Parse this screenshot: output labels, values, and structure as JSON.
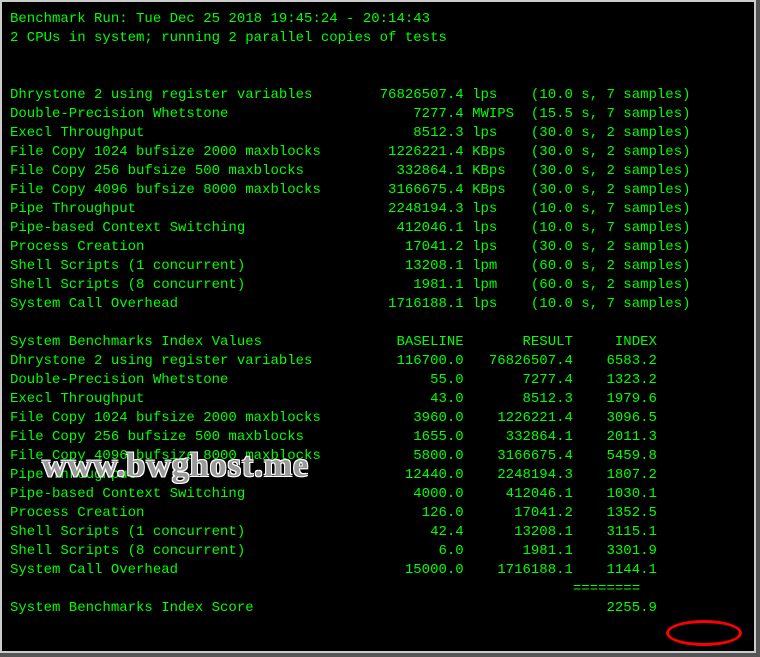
{
  "header": {
    "run_line": "Benchmark Run: Tue Dec 25 2018 19:45:24 - 20:14:43",
    "cpu_line": "2 CPUs in system; running 2 parallel copies of tests"
  },
  "results": [
    {
      "name": "Dhrystone 2 using register variables",
      "value": "76826507.4",
      "unit": "lps",
      "timing": "(10.0 s, 7 samples)"
    },
    {
      "name": "Double-Precision Whetstone",
      "value": "7277.4",
      "unit": "MWIPS",
      "timing": "(15.5 s, 7 samples)"
    },
    {
      "name": "Execl Throughput",
      "value": "8512.3",
      "unit": "lps",
      "timing": "(30.0 s, 2 samples)"
    },
    {
      "name": "File Copy 1024 bufsize 2000 maxblocks",
      "value": "1226221.4",
      "unit": "KBps",
      "timing": "(30.0 s, 2 samples)"
    },
    {
      "name": "File Copy 256 bufsize 500 maxblocks",
      "value": "332864.1",
      "unit": "KBps",
      "timing": "(30.0 s, 2 samples)"
    },
    {
      "name": "File Copy 4096 bufsize 8000 maxblocks",
      "value": "3166675.4",
      "unit": "KBps",
      "timing": "(30.0 s, 2 samples)"
    },
    {
      "name": "Pipe Throughput",
      "value": "2248194.3",
      "unit": "lps",
      "timing": "(10.0 s, 7 samples)"
    },
    {
      "name": "Pipe-based Context Switching",
      "value": "412046.1",
      "unit": "lps",
      "timing": "(10.0 s, 7 samples)"
    },
    {
      "name": "Process Creation",
      "value": "17041.2",
      "unit": "lps",
      "timing": "(30.0 s, 2 samples)"
    },
    {
      "name": "Shell Scripts (1 concurrent)",
      "value": "13208.1",
      "unit": "lpm",
      "timing": "(60.0 s, 2 samples)"
    },
    {
      "name": "Shell Scripts (8 concurrent)",
      "value": "1981.1",
      "unit": "lpm",
      "timing": "(60.0 s, 2 samples)"
    },
    {
      "name": "System Call Overhead",
      "value": "1716188.1",
      "unit": "lps",
      "timing": "(10.0 s, 7 samples)"
    }
  ],
  "index_header": {
    "title": "System Benchmarks Index Values",
    "baseline": "BASELINE",
    "result": "RESULT",
    "index": "INDEX"
  },
  "indexes": [
    {
      "name": "Dhrystone 2 using register variables",
      "baseline": "116700.0",
      "result": "76826507.4",
      "index": "6583.2"
    },
    {
      "name": "Double-Precision Whetstone",
      "baseline": "55.0",
      "result": "7277.4",
      "index": "1323.2"
    },
    {
      "name": "Execl Throughput",
      "baseline": "43.0",
      "result": "8512.3",
      "index": "1979.6"
    },
    {
      "name": "File Copy 1024 bufsize 2000 maxblocks",
      "baseline": "3960.0",
      "result": "1226221.4",
      "index": "3096.5"
    },
    {
      "name": "File Copy 256 bufsize 500 maxblocks",
      "baseline": "1655.0",
      "result": "332864.1",
      "index": "2011.3"
    },
    {
      "name": "File Copy 4096 bufsize 8000 maxblocks",
      "baseline": "5800.0",
      "result": "3166675.4",
      "index": "5459.8"
    },
    {
      "name": "Pipe Throughput",
      "baseline": "12440.0",
      "result": "2248194.3",
      "index": "1807.2"
    },
    {
      "name": "Pipe-based Context Switching",
      "baseline": "4000.0",
      "result": "412046.1",
      "index": "1030.1"
    },
    {
      "name": "Process Creation",
      "baseline": "126.0",
      "result": "17041.2",
      "index": "1352.5"
    },
    {
      "name": "Shell Scripts (1 concurrent)",
      "baseline": "42.4",
      "result": "13208.1",
      "index": "3115.1"
    },
    {
      "name": "Shell Scripts (8 concurrent)",
      "baseline": "6.0",
      "result": "1981.1",
      "index": "3301.9"
    },
    {
      "name": "System Call Overhead",
      "baseline": "15000.0",
      "result": "1716188.1",
      "index": "1144.1"
    }
  ],
  "divider": "                                                                   ========",
  "score": {
    "label": "System Benchmarks Index Score",
    "value": "2255.9"
  },
  "watermark": "www.bwghost.me"
}
